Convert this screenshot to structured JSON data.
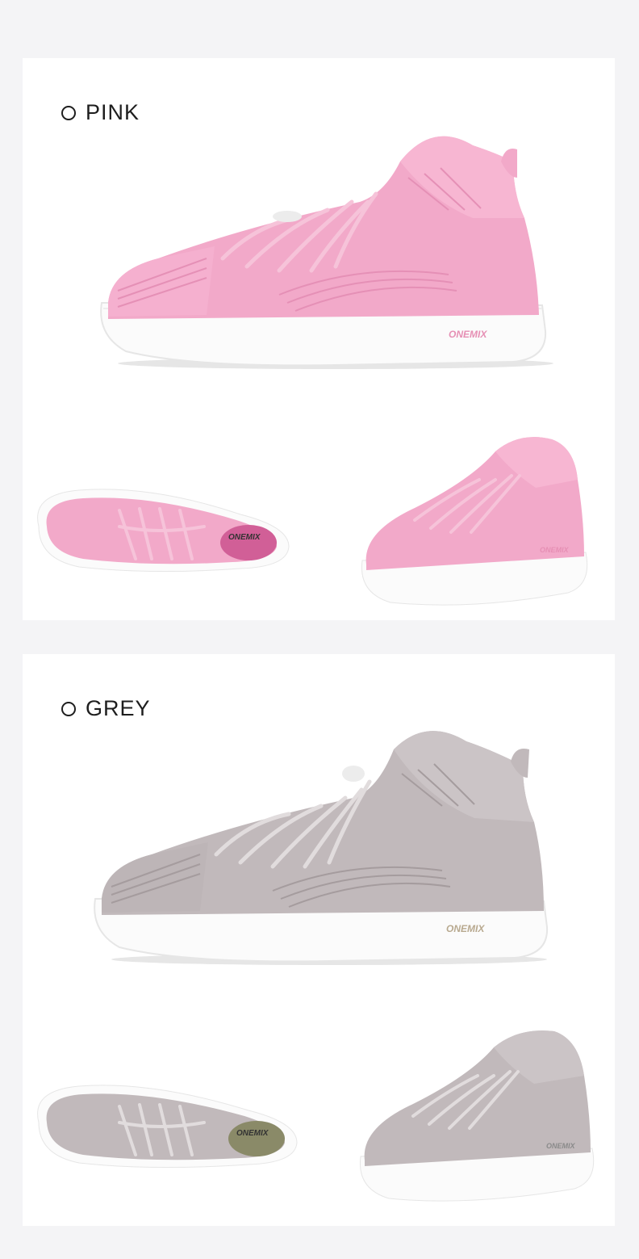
{
  "variants": [
    {
      "label": "PINK",
      "selector_icon": "radio-circle-icon",
      "colors": {
        "upper": "#f2a9c9",
        "upper_dark": "#e790b7",
        "knit": "#f7b6d2",
        "lace": "#f6c3d9",
        "sole": "#fbfbfb",
        "sole_edge": "#ececec"
      },
      "brand_mark": "ONEMIX",
      "insole_mark": "ONEMIX"
    },
    {
      "label": "GREY",
      "selector_icon": "radio-circle-icon",
      "colors": {
        "upper": "#c1b9bb",
        "upper_dark": "#aaa1a3",
        "knit": "#cbc4c6",
        "lace": "#e1dcdd",
        "sole": "#fbfbfb",
        "sole_edge": "#ececec"
      },
      "brand_mark": "ONEMIX",
      "insole_mark": "ONEMIX"
    }
  ]
}
